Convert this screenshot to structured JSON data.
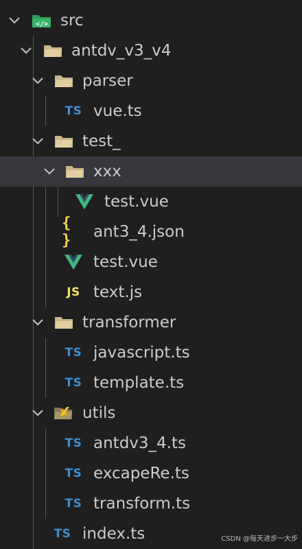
{
  "explorer": {
    "rows": [
      {
        "label": "src",
        "kind": "folder",
        "icon": "folder-src-icon"
      },
      {
        "label": "antdv_v3_v4",
        "kind": "folder",
        "icon": "folder-icon"
      },
      {
        "label": "parser",
        "kind": "folder",
        "icon": "folder-icon"
      },
      {
        "label": "vue.ts",
        "kind": "file",
        "icon": "typescript-file-icon",
        "badge": "TS"
      },
      {
        "label": "test_",
        "kind": "folder",
        "icon": "folder-icon"
      },
      {
        "label": "xxx",
        "kind": "folder",
        "icon": "folder-icon",
        "selected": true
      },
      {
        "label": "test.vue",
        "kind": "file",
        "icon": "vue-file-icon"
      },
      {
        "label": "ant3_4.json",
        "kind": "file",
        "icon": "json-file-icon",
        "badge": "{ }"
      },
      {
        "label": "test.vue",
        "kind": "file",
        "icon": "vue-file-icon"
      },
      {
        "label": "text.js",
        "kind": "file",
        "icon": "javascript-file-icon",
        "badge": "JS"
      },
      {
        "label": "transformer",
        "kind": "folder",
        "icon": "folder-icon"
      },
      {
        "label": "javascript.ts",
        "kind": "file",
        "icon": "typescript-file-icon",
        "badge": "TS"
      },
      {
        "label": "template.ts",
        "kind": "file",
        "icon": "typescript-file-icon",
        "badge": "TS"
      },
      {
        "label": "utils",
        "kind": "folder",
        "icon": "folder-utils-icon"
      },
      {
        "label": "antdv3_4.ts",
        "kind": "file",
        "icon": "typescript-file-icon",
        "badge": "TS"
      },
      {
        "label": "excapeRe.ts",
        "kind": "file",
        "icon": "typescript-file-icon",
        "badge": "TS"
      },
      {
        "label": "transform.ts",
        "kind": "file",
        "icon": "typescript-file-icon",
        "badge": "TS"
      },
      {
        "label": "index.ts",
        "kind": "file",
        "icon": "typescript-file-icon",
        "badge": "TS"
      }
    ]
  },
  "colors": {
    "background": "#1f1f1f",
    "selected_row": "#37373d",
    "text": "#cccccc",
    "typescript": "#3d8fd1",
    "javascript": "#f1e05a",
    "json": "#f1d54a",
    "vue_outer": "#41b883",
    "vue_inner": "#35495e",
    "folder": "#c9b78a",
    "src_folder": "#2e9e5b"
  },
  "watermark": "CSDN @每天进步一大步"
}
